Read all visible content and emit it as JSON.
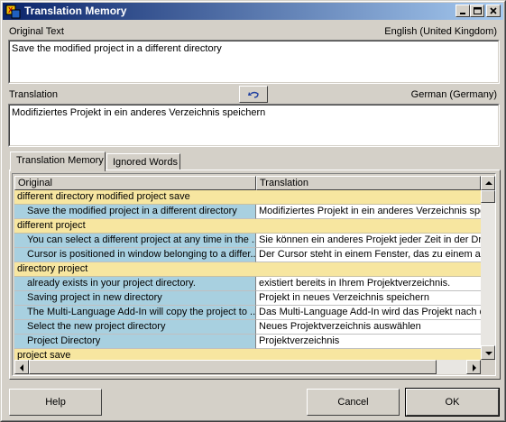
{
  "window": {
    "title": "Translation Memory"
  },
  "original": {
    "label": "Original Text",
    "language": "English (United Kingdom)",
    "text": "Save the modified project in a different directory"
  },
  "translation": {
    "label": "Translation",
    "language": "German (Germany)",
    "text": "Modifiziertes Projekt in ein anderes Verzeichnis speichern"
  },
  "tabs": [
    {
      "label": "Translation Memory",
      "active": true
    },
    {
      "label": "Ignored Words",
      "active": false
    }
  ],
  "grid": {
    "columns": [
      "Original",
      "Translation"
    ],
    "rows": [
      {
        "type": "group",
        "text": "different directory modified project save"
      },
      {
        "type": "item",
        "original": "Save the modified project in a different directory",
        "translation": "Modifiziertes Projekt in ein anderes Verzeichnis speic"
      },
      {
        "type": "group",
        "text": "different project"
      },
      {
        "type": "item",
        "original": "You can select a different project at any time in the ...",
        "translation": "Sie können ein anderes Projekt jeder Zeit in der Drop"
      },
      {
        "type": "item",
        "original": "Cursor is positioned in window belonging to a differ...",
        "translation": "Der Cursor steht in einem Fenster, das zu einem ande"
      },
      {
        "type": "group",
        "text": "directory project"
      },
      {
        "type": "item",
        "original": " already exists in your project directory.",
        "translation": " existiert bereits in Ihrem Projektverzeichnis."
      },
      {
        "type": "item",
        "original": "Saving project in new directory",
        "translation": "Projekt in neues Verzeichnis speichern"
      },
      {
        "type": "item",
        "original": "The Multi-Language Add-In will copy the project to ...",
        "translation": "Das Multi-Language Add-In wird das Projekt nach de"
      },
      {
        "type": "item",
        "original": "Select the new project directory",
        "translation": "Neues Projektverzeichnis auswählen"
      },
      {
        "type": "item",
        "original": "Project Directory",
        "translation": "Projektverzeichnis"
      },
      {
        "type": "group",
        "text": "project save"
      },
      {
        "type": "item",
        "original": "",
        "translation": ""
      }
    ]
  },
  "buttons": {
    "help": "Help",
    "cancel": "Cancel",
    "ok": "OK"
  },
  "colors": {
    "group_row": "#f7e6a0",
    "original_cell": "#a8d0e0",
    "titlebar_start": "#0a246a",
    "titlebar_end": "#a6caf0"
  },
  "icons": {
    "app": "app-icon",
    "swap": "undo-arrow-icon",
    "minimize": "minimize-icon",
    "maximize": "maximize-icon",
    "close": "close-icon"
  }
}
